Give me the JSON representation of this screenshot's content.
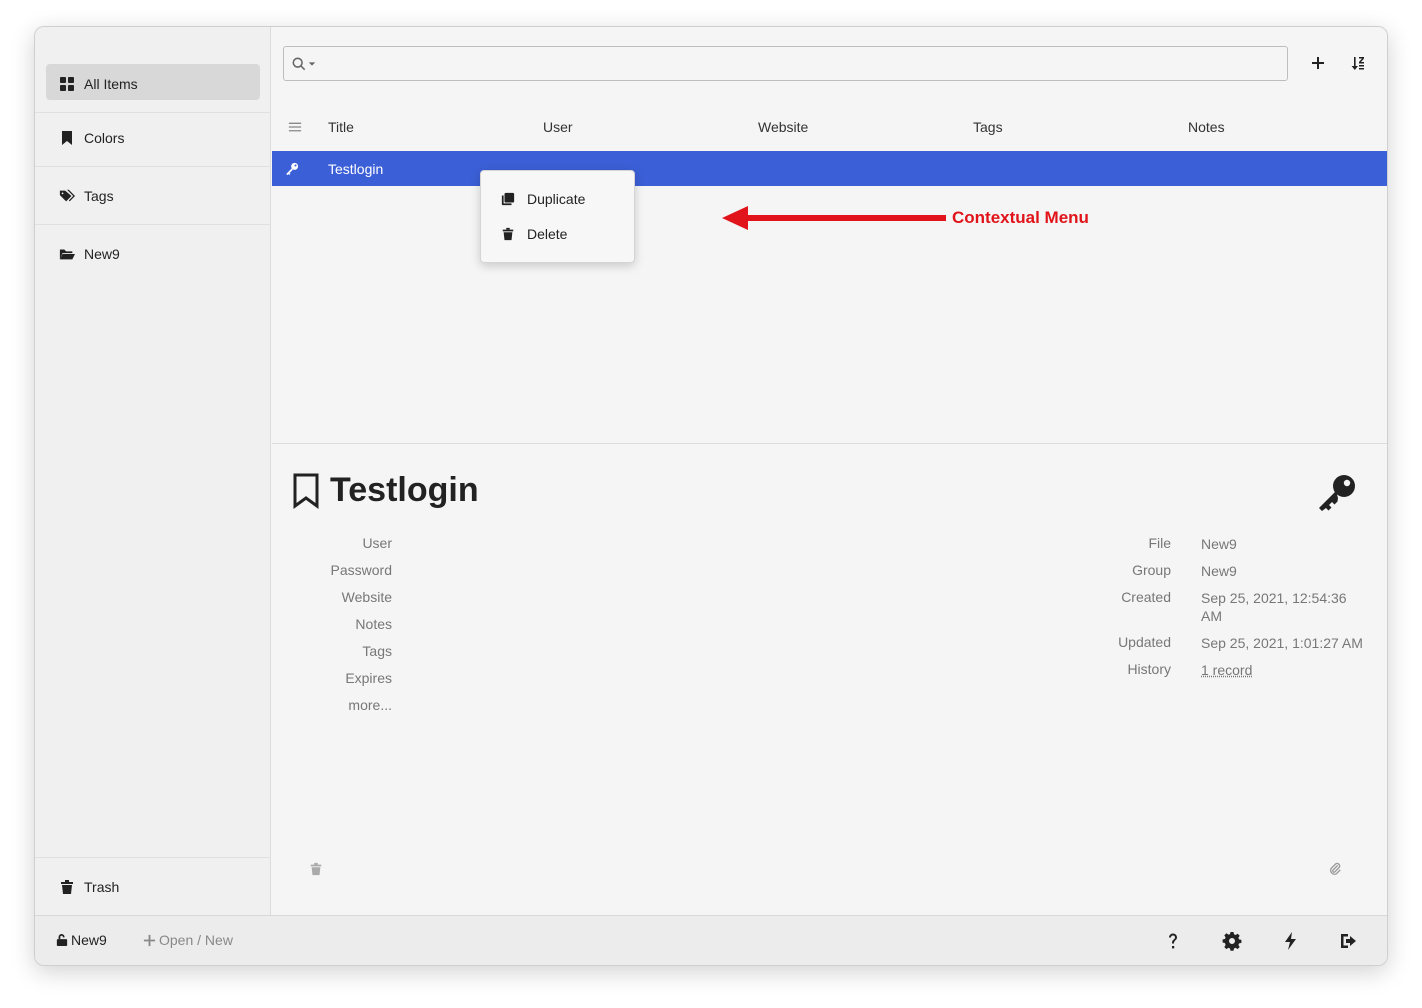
{
  "sidebar": {
    "items": [
      {
        "label": "All Items",
        "icon": "grid-icon"
      },
      {
        "label": "Colors",
        "icon": "bookmark-icon"
      },
      {
        "label": "Tags",
        "icon": "tags-icon"
      },
      {
        "label": "New9",
        "icon": "folder-open-icon"
      }
    ],
    "trash_label": "Trash"
  },
  "search": {
    "value": "",
    "placeholder": ""
  },
  "columns": [
    "Title",
    "User",
    "Website",
    "Tags",
    "Notes"
  ],
  "rows": [
    {
      "title": "Testlogin",
      "icon": "key-icon"
    }
  ],
  "context_menu": {
    "items": [
      {
        "label": "Duplicate",
        "icon": "copy-icon"
      },
      {
        "label": "Delete",
        "icon": "trash-icon"
      }
    ]
  },
  "annotation": {
    "label": "Contextual Menu",
    "color": "#e0141a"
  },
  "detail": {
    "title": "Testlogin",
    "fields": [
      "User",
      "Password",
      "Website",
      "Notes",
      "Tags",
      "Expires",
      "more..."
    ],
    "meta": [
      {
        "label": "File",
        "value": "New9"
      },
      {
        "label": "Group",
        "value": "New9"
      },
      {
        "label": "Created",
        "value": "Sep 25, 2021, 12:54:36 AM"
      },
      {
        "label": "Updated",
        "value": "Sep 25, 2021, 1:01:27 AM"
      },
      {
        "label": "History",
        "value": "1 record"
      }
    ]
  },
  "footer": {
    "file_label": "New9",
    "open_new_label": "Open / New",
    "buttons": [
      "help-icon",
      "settings-icon",
      "generator-icon",
      "lock-exit-icon"
    ]
  },
  "colors": {
    "selection": "#3b5fd6",
    "accent_annotation": "#e0141a"
  }
}
